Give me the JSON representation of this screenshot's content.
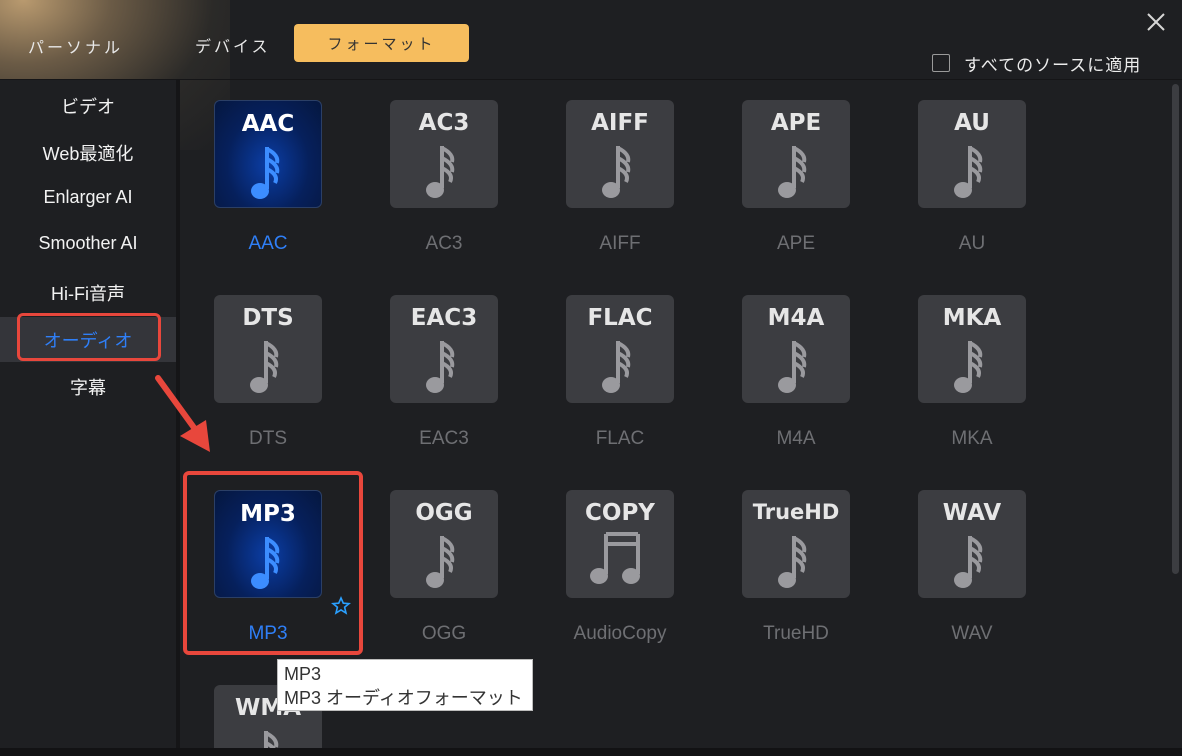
{
  "topbar": {
    "tabs": [
      {
        "label": "パーソナル"
      },
      {
        "label": "デバイス"
      },
      {
        "label": "フォーマット"
      }
    ],
    "apply_all_label": "すべてのソースに適用",
    "apply_all_checked": false,
    "accent_color": "#f6bd5e"
  },
  "sidebar": {
    "items": [
      {
        "label": "ビデオ"
      },
      {
        "label": "Web最適化"
      },
      {
        "label": "Enlarger AI"
      },
      {
        "label": "Smoother AI"
      },
      {
        "label": "Hi-Fi音声"
      },
      {
        "label": "オーディオ"
      },
      {
        "label": "字幕"
      }
    ],
    "active_index": 5
  },
  "formats": [
    {
      "icon_text": "AAC",
      "caption": "AAC",
      "selected": true,
      "icon": "music-note-icon"
    },
    {
      "icon_text": "AC3",
      "caption": "AC3",
      "selected": false,
      "icon": "music-note-icon"
    },
    {
      "icon_text": "AIFF",
      "caption": "AIFF",
      "selected": false,
      "icon": "music-note-icon"
    },
    {
      "icon_text": "APE",
      "caption": "APE",
      "selected": false,
      "icon": "music-note-icon"
    },
    {
      "icon_text": "AU",
      "caption": "AU",
      "selected": false,
      "icon": "music-note-icon"
    },
    {
      "icon_text": "DTS",
      "caption": "DTS",
      "selected": false,
      "icon": "music-note-icon"
    },
    {
      "icon_text": "EAC3",
      "caption": "EAC3",
      "selected": false,
      "icon": "music-note-icon"
    },
    {
      "icon_text": "FLAC",
      "caption": "FLAC",
      "selected": false,
      "icon": "music-note-icon"
    },
    {
      "icon_text": "M4A",
      "caption": "M4A",
      "selected": false,
      "icon": "music-note-icon"
    },
    {
      "icon_text": "MKA",
      "caption": "MKA",
      "selected": false,
      "icon": "music-note-icon"
    },
    {
      "icon_text": "MP3",
      "caption": "MP3",
      "selected": true,
      "icon": "music-note-icon"
    },
    {
      "icon_text": "OGG",
      "caption": "OGG",
      "selected": false,
      "icon": "music-note-icon"
    },
    {
      "icon_text": "COPY",
      "caption": "AudioCopy",
      "selected": false,
      "icon": "double-note-icon"
    },
    {
      "icon_text": "TrueHD",
      "caption": "TrueHD",
      "selected": false,
      "icon": "music-note-icon"
    },
    {
      "icon_text": "WAV",
      "caption": "WAV",
      "selected": false,
      "icon": "music-note-icon"
    },
    {
      "icon_text": "WMA",
      "caption": "",
      "selected": false,
      "icon": "music-note-icon"
    }
  ],
  "tooltip": {
    "line1": "MP3",
    "line2": "MP3 オーディオフォーマット"
  },
  "colors": {
    "selected_caption": "#2f7ff7",
    "highlight_box": "#e8473c"
  }
}
